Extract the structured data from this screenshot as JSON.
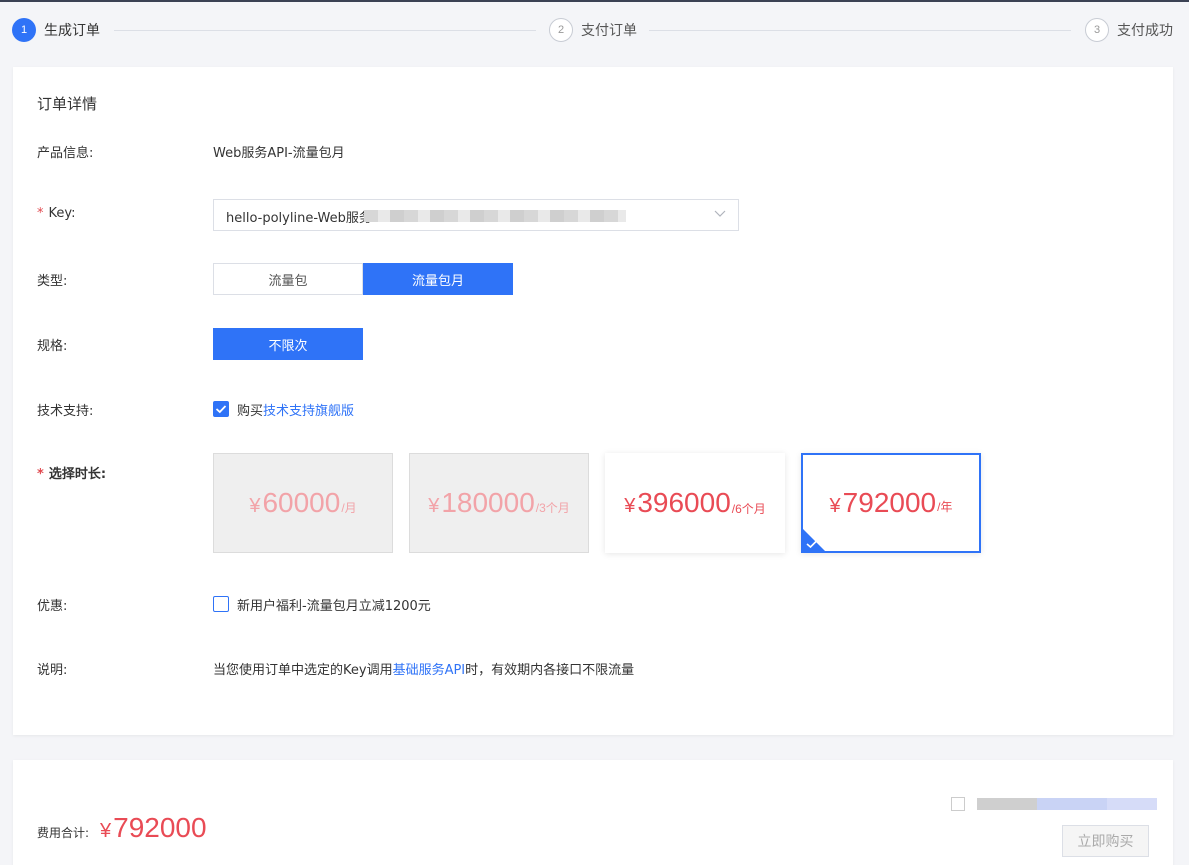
{
  "steps": [
    {
      "num": "1",
      "label": "生成订单"
    },
    {
      "num": "2",
      "label": "支付订单"
    },
    {
      "num": "3",
      "label": "支付成功"
    }
  ],
  "order": {
    "title": "订单详情",
    "product_label": "产品信息:",
    "product_value": "Web服务API-流量包月",
    "key_label": "Key:",
    "key_value": "hello-polyline-Web服务",
    "type_label": "类型:",
    "type_options": [
      "流量包",
      "流量包月"
    ],
    "type_selected": "流量包月",
    "spec_label": "规格:",
    "spec_value": "不限次",
    "support_label": "技术支持:",
    "support_prefix": "购买",
    "support_link": "技术支持旗舰版",
    "support_checked": true,
    "duration_label": "选择时长:",
    "durations": [
      {
        "currency": "¥",
        "amount": "60000",
        "unit": "/月",
        "state": "disabled"
      },
      {
        "currency": "¥",
        "amount": "180000",
        "unit": "/3个月",
        "state": "disabled"
      },
      {
        "currency": "¥",
        "amount": "396000",
        "unit": "/6个月",
        "state": "normal"
      },
      {
        "currency": "¥",
        "amount": "792000",
        "unit": "/年",
        "state": "selected"
      }
    ],
    "discount_label": "优惠:",
    "discount_text": "新用户福利-流量包月立减1200元",
    "discount_checked": false,
    "note_label": "说明:",
    "note_prefix": "当您使用订单中选定的Key调用",
    "note_link": "基础服务API",
    "note_suffix": "时，有效期内各接口不限流量"
  },
  "footer": {
    "total_label": "费用合计:",
    "total_currency": "¥",
    "total_amount": "792000",
    "buy_label": "立即购买"
  },
  "colors": {
    "accent": "#2f73f7",
    "price": "#e94b55",
    "price_disabled": "#f2a3a8"
  }
}
